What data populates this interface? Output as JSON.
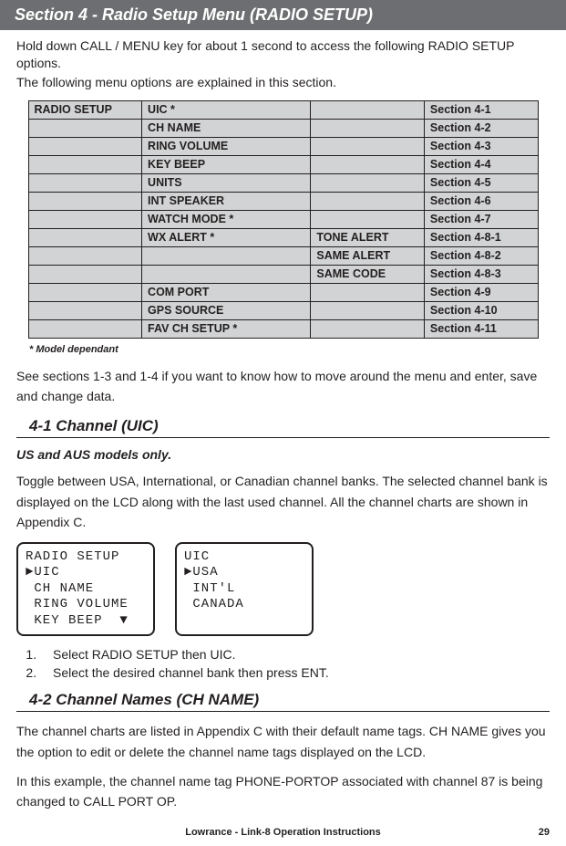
{
  "section_header": "Section 4 -  Radio Setup Menu (RADIO SETUP)",
  "intro": {
    "p1": "Hold down CALL / MENU key for about 1 second to access the following RADIO SETUP options.",
    "p2": "The following menu options are explained in this section."
  },
  "table": {
    "rows": [
      {
        "c1": "RADIO SETUP",
        "c2": "UIC   *",
        "c3": "",
        "c4": "Section 4-1"
      },
      {
        "c1": "",
        "c2": "CH NAME",
        "c3": "",
        "c4": "Section 4-2"
      },
      {
        "c1": "",
        "c2": "RING VOLUME",
        "c3": "",
        "c4": "Section 4-3"
      },
      {
        "c1": "",
        "c2": "KEY BEEP",
        "c3": "",
        "c4": "Section 4-4"
      },
      {
        "c1": "",
        "c2": "UNITS",
        "c3": "",
        "c4": "Section 4-5"
      },
      {
        "c1": "",
        "c2": "INT SPEAKER",
        "c3": "",
        "c4": "Section 4-6"
      },
      {
        "c1": "",
        "c2": "WATCH MODE   *",
        "c3": "",
        "c4": "Section 4-7"
      },
      {
        "c1": "",
        "c2": "WX ALERT   *",
        "c3": "TONE ALERT",
        "c4": "Section 4-8-1"
      },
      {
        "c1": "",
        "c2": "",
        "c3": "SAME ALERT",
        "c4": "Section 4-8-2"
      },
      {
        "c1": "",
        "c2": "",
        "c3": "SAME CODE",
        "c4": "Section 4-8-3"
      },
      {
        "c1": "",
        "c2": "COM PORT",
        "c3": "",
        "c4": "Section 4-9"
      },
      {
        "c1": "",
        "c2": "GPS SOURCE",
        "c3": "",
        "c4": "Section 4-10"
      },
      {
        "c1": "",
        "c2": "FAV CH SETUP  *",
        "c3": "",
        "c4": "Section 4-11"
      }
    ]
  },
  "footnote": "* Model dependant",
  "after_table_text": "See sections 1-3 and 1-4 if you want to know how to move around the menu and enter, save and change data.",
  "sub41": {
    "header": "4-1 Channel (UIC)",
    "note": "US and AUS models only.",
    "text": "Toggle between USA, International, or Canadian channel banks. The selected channel bank is displayed on the LCD along with the last used channel. All the channel charts are shown in Appendix C.",
    "lcd1": "RADIO SETUP\n►UIC\n CH NAME\n RING VOLUME\n KEY BEEP  ▼",
    "lcd2": "UIC\n►USA\n INT'L\n CANADA",
    "step1": "Select RADIO SETUP then UIC.",
    "step2": "Select the desired channel bank then press ENT."
  },
  "sub42": {
    "header": "4-2 Channel Names (CH NAME)",
    "p1": "The channel charts are listed in Appendix C with their default name tags. CH NAME gives you the option to edit or delete the channel name tags displayed on the LCD.",
    "p2": "In this example, the channel name tag PHONE-PORTOP associated with channel 87 is being changed to CALL PORT OP."
  },
  "footer": {
    "center": "Lowrance - Link-8 Operation Instructions",
    "page": "29"
  }
}
